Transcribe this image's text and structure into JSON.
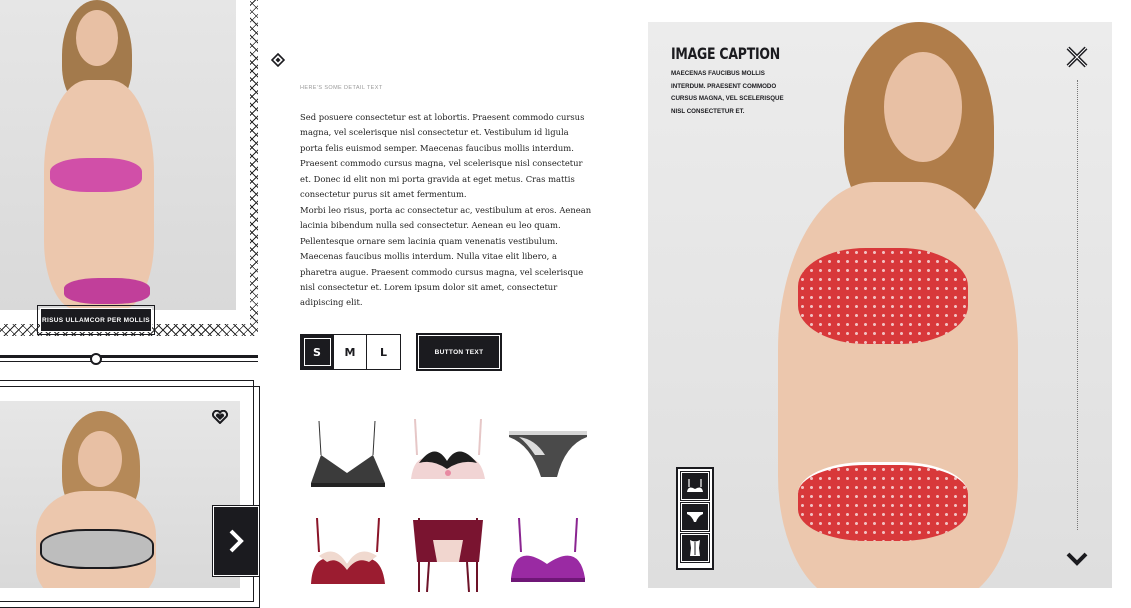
{
  "left": {
    "top_photo_caption": "RISUS ULLAMCOR PER MOLLIS"
  },
  "middle": {
    "eyebrow": "HERE'S SOME DETAIL TEXT",
    "paragraphs": [
      "Sed posuere consectetur est at lobortis. Praesent commodo cursus magna, vel scelerisque nisl consectetur et. Vestibulum id ligula porta felis euismod semper. Maecenas faucibus mollis interdum. Praesent commodo cursus magna, vel scelerisque nisl consectetur et. Donec id elit non mi porta gravida at eget metus. Cras mattis consectetur purus sit amet fermentum.",
      "Morbi leo risus, porta ac consectetur ac, vestibulum at eros. Aenean lacinia bibendum nulla sed consectetur. Aenean eu leo quam. Pellentesque ornare sem lacinia quam venenatis vestibulum. Maecenas faucibus mollis interdum. Nulla vitae elit libero, a pharetra augue. Praesent commodo cursus magna, vel scelerisque nisl consectetur et. Lorem ipsum dolor sit amet, consectetur adipiscing elit."
    ],
    "sizes": [
      "S",
      "M",
      "L"
    ],
    "selected_size": "S",
    "button_label": "BUTTON TEXT"
  },
  "hero": {
    "caption_title": "IMAGE CAPTION",
    "caption_lines": [
      "MAECENAS FAUCIBUS MOLLIS",
      "INTERDUM. PRAESENT COMMODO",
      "CURSUS MAGNA, VEL SCELERISQUE",
      "NISL CONSECTETUR ET."
    ]
  },
  "colors": {
    "ink": "#1b1b1f",
    "hero_red": "#d8383a",
    "pink": "#d14fa8",
    "purple": "#9a2aa3",
    "burgundy": "#8a1428"
  },
  "icons": [
    "diamond-icon",
    "heart-icon",
    "chevron-right-icon",
    "close-icon",
    "chevron-down-icon",
    "bra-icon",
    "briefs-icon",
    "corset-icon"
  ]
}
